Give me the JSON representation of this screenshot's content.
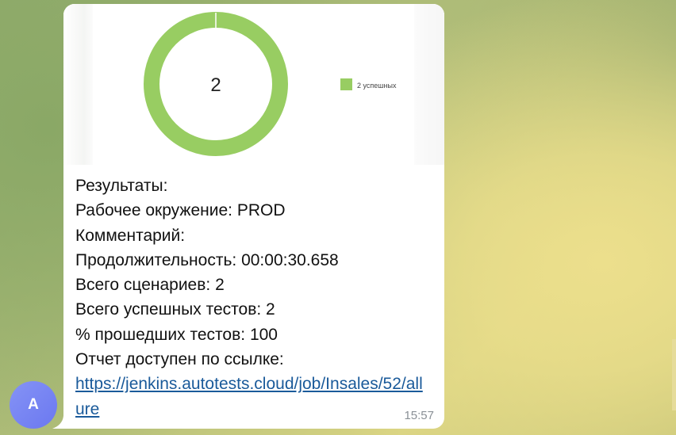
{
  "chart": {
    "center_value": "2",
    "legend_label": "2 успешных",
    "color_success": "#98cd62"
  },
  "chart_data": {
    "type": "pie",
    "categories": [
      "успешных"
    ],
    "values": [
      2
    ]
  },
  "message": {
    "results_label": "Результаты:",
    "env_label": "Рабочее окружение:",
    "env_value": "PROD",
    "comment_label": "Комментарий:",
    "duration_label": "Продолжительность:",
    "duration_value": "00:00:30.658",
    "scenarios_label": "Всего сценариев:",
    "scenarios_value": "2",
    "passed_label": "Всего успешных тестов:",
    "passed_value": "2",
    "percent_label": "% прошедших тестов:",
    "percent_value": "100",
    "report_label": "Отчет доступен по ссылке:",
    "report_link": "https://jenkins.autotests.cloud/job/Insales/52/allure",
    "time": "15:57"
  },
  "avatar": {
    "letter": "A",
    "color": "#6b78f0"
  }
}
